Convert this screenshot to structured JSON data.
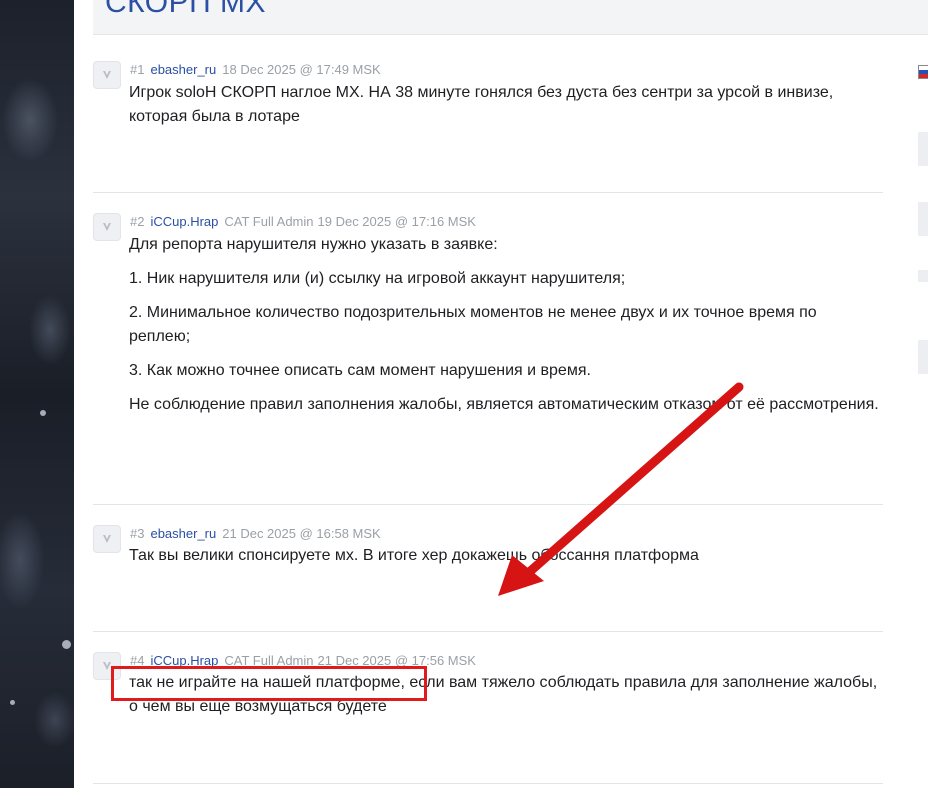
{
  "page": {
    "title": "СКОРП МХ"
  },
  "posts": [
    {
      "number": "#1",
      "username": "ebasher_ru",
      "role": "",
      "date": "18 Dec 2025 @ 17:49 MSK",
      "paragraphs": [
        "Игрок soloH СКОРП наглое MX. НА 38 минуте гонялся без дуста без сентри за урсой в инвизе, которая была в лотаре"
      ]
    },
    {
      "number": "#2",
      "username": "iCCup.Hrap",
      "role": "CAT Full Admin",
      "date": "19 Dec 2025 @ 17:16 MSK",
      "paragraphs": [
        "Для репорта нарушителя нужно указать в заявке:",
        "1. Ник нарушителя или (и) ссылку на игровой аккаунт нарушителя;",
        "2. Минимальное количество подозрительных моментов не менее двух и их точное время по реплею;",
        "3. Как можно точнее описать сам момент нарушения и время.",
        "Не соблюдение правил заполнения жалобы, является автоматическим отказом от её рассмотрения."
      ]
    },
    {
      "number": "#3",
      "username": "ebasher_ru",
      "role": "",
      "date": "21 Dec 2025 @ 16:58 MSK",
      "paragraphs": [
        "Так вы велики спонсируете мх. В итоге хер докажешь обоссання платформа"
      ]
    },
    {
      "number": "#4",
      "username": "iCCup.Hrap",
      "role": "CAT Full Admin",
      "date": "21 Dec 2025 @ 17:56 MSK",
      "paragraphs": [
        "так не играйте на нашей платформе, если вам тяжело соблюдать правила для заполнение жалобы, о чем вы еще возмущаться будете"
      ]
    }
  ],
  "annotations": {
    "arrow_color": "#d71414",
    "box_color": "#e01b1b"
  },
  "icons": {
    "avatar": "user-avatar-icon",
    "flag": "ru-flag-icon"
  }
}
